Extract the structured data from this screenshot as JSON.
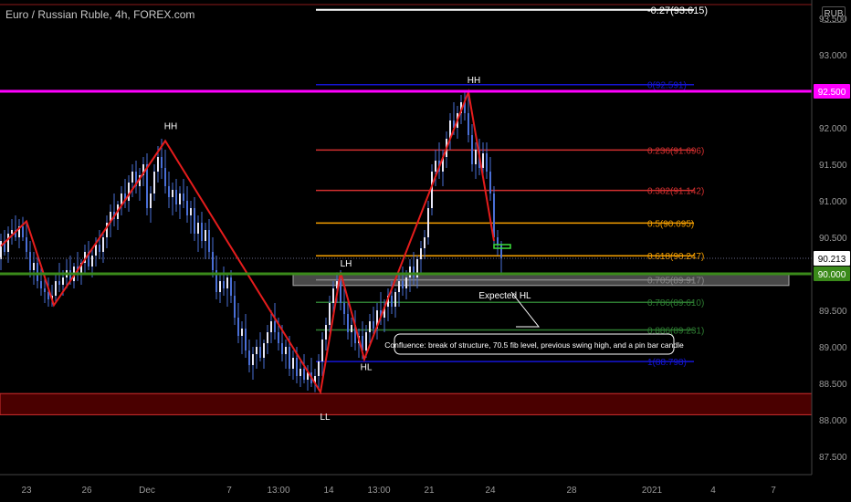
{
  "header": {
    "title": "Euro / Russian Ruble, 4h, FOREX.com",
    "currency_button": "RUB"
  },
  "colors": {
    "background": "#000000",
    "candle": "#4a6fd6",
    "zigzag": "#e51c1c",
    "magenta": "#ff00ff",
    "green": "#3a8a1a",
    "fib_red": "#d32f2f",
    "fib_orange": "#f59f00",
    "fib_green": "#2e7d32",
    "fib_blue": "#1515d6",
    "zone_fill": "#4a0000",
    "zone_border": "#d32f2f"
  },
  "chart_data": {
    "type": "candlestick",
    "symbol": "Euro / Russian Ruble",
    "timeframe": "4h",
    "source": "FOREX.com",
    "y_axis": {
      "range": [
        87.25,
        93.75
      ],
      "ticks": [
        "93.500",
        "93.000",
        "92.500",
        "92.000",
        "91.500",
        "91.000",
        "90.500",
        "90.000",
        "89.500",
        "89.000",
        "88.500",
        "88.000",
        "87.500"
      ]
    },
    "x_axis": {
      "ticks": [
        "23",
        "26",
        "Dec",
        "7",
        "13:00",
        "14",
        "13:00",
        "21",
        "24",
        "28",
        "2021",
        "4",
        "7"
      ]
    },
    "price_labels": [
      {
        "value": "92.500",
        "bg": "#ff00ff",
        "fg": "#ffffff",
        "price": 92.5
      },
      {
        "value": "90.213",
        "bg": "#ffffff",
        "fg": "#000000",
        "price": 90.213
      },
      {
        "value": "90.000",
        "bg": "#3a8a1a",
        "fg": "#ffffff",
        "price": 90.0
      }
    ],
    "horizontal_levels": [
      {
        "name": "magenta-level",
        "price": 92.5,
        "color": "#ff00ff"
      },
      {
        "name": "green-level",
        "price": 90.0,
        "color": "#3a8a1a"
      }
    ],
    "fibonacci": [
      {
        "label": "-0.27(93.615)",
        "price": 93.615,
        "color": "#ffffff"
      },
      {
        "label": "0(92.591)",
        "price": 92.591,
        "color": "#1515d6"
      },
      {
        "label": "0.236(91.696)",
        "price": 91.696,
        "color": "#d32f2f"
      },
      {
        "label": "0.382(91.142)",
        "price": 91.142,
        "color": "#d32f2f"
      },
      {
        "label": "0.5(90.695)",
        "price": 90.695,
        "color": "#f59f00"
      },
      {
        "label": "0.618(90.247)",
        "price": 90.247,
        "color": "#f59f00"
      },
      {
        "label": "0.705(89.917)",
        "price": 89.917,
        "color": "#888888"
      },
      {
        "label": "0.786(89.610)",
        "price": 89.61,
        "color": "#2e7d32"
      },
      {
        "label": "0.886(89.231)",
        "price": 89.231,
        "color": "#2e7d32"
      },
      {
        "label": "1(88.798)",
        "price": 88.798,
        "color": "#1515d6"
      }
    ],
    "zigzag": [
      {
        "t": 0,
        "price": 90.38
      },
      {
        "t": 28,
        "price": 90.72
      },
      {
        "t": 58,
        "price": 89.57
      },
      {
        "t": 180,
        "price": 91.82
      },
      {
        "t": 350,
        "price": 88.38
      },
      {
        "t": 372,
        "price": 90.02
      },
      {
        "t": 398,
        "price": 88.83
      },
      {
        "t": 512,
        "price": 92.49
      },
      {
        "t": 540,
        "price": 90.45
      }
    ],
    "swing_labels": [
      {
        "text": "HH",
        "t": 186,
        "price": 91.98
      },
      {
        "text": "LH",
        "t": 378,
        "price": 90.1
      },
      {
        "text": "HL",
        "t": 400,
        "price": 88.68
      },
      {
        "text": "HH",
        "t": 518,
        "price": 92.61
      },
      {
        "text": "LL",
        "t": 355,
        "price": 88.0
      }
    ],
    "annotations": {
      "expected_label": "Expected HL",
      "note": "Confluence: break of structure, 70.5 fib level, previous swing high, and a pin bar candle"
    },
    "candles": [
      {
        "t": 0,
        "o": 90.2,
        "h": 90.55,
        "l": 90.05,
        "c": 90.45
      },
      {
        "t": 4,
        "o": 90.45,
        "h": 90.6,
        "l": 90.25,
        "c": 90.3
      },
      {
        "t": 8,
        "o": 90.3,
        "h": 90.65,
        "l": 90.15,
        "c": 90.55
      },
      {
        "t": 12,
        "o": 90.55,
        "h": 90.75,
        "l": 90.4,
        "c": 90.6
      },
      {
        "t": 16,
        "o": 90.6,
        "h": 90.8,
        "l": 90.45,
        "c": 90.5
      },
      {
        "t": 20,
        "o": 90.5,
        "h": 90.75,
        "l": 90.35,
        "c": 90.65
      },
      {
        "t": 24,
        "o": 90.65,
        "h": 90.78,
        "l": 90.45,
        "c": 90.5
      },
      {
        "t": 28,
        "o": 90.5,
        "h": 90.7,
        "l": 90.2,
        "c": 90.3
      },
      {
        "t": 32,
        "o": 90.3,
        "h": 90.45,
        "l": 89.95,
        "c": 90.05
      },
      {
        "t": 36,
        "o": 90.05,
        "h": 90.3,
        "l": 89.85,
        "c": 90.15
      },
      {
        "t": 40,
        "o": 90.15,
        "h": 90.25,
        "l": 89.8,
        "c": 89.9
      },
      {
        "t": 44,
        "o": 89.9,
        "h": 90.1,
        "l": 89.7,
        "c": 89.8
      },
      {
        "t": 48,
        "o": 89.8,
        "h": 90.0,
        "l": 89.6,
        "c": 89.75
      },
      {
        "t": 52,
        "o": 89.75,
        "h": 89.95,
        "l": 89.55,
        "c": 89.65
      },
      {
        "t": 56,
        "o": 89.65,
        "h": 89.85,
        "l": 89.55,
        "c": 89.7
      },
      {
        "t": 60,
        "o": 89.7,
        "h": 90.0,
        "l": 89.6,
        "c": 89.9
      },
      {
        "t": 64,
        "o": 89.9,
        "h": 90.15,
        "l": 89.75,
        "c": 89.85
      },
      {
        "t": 68,
        "o": 89.85,
        "h": 90.05,
        "l": 89.7,
        "c": 89.95
      },
      {
        "t": 72,
        "o": 89.95,
        "h": 90.2,
        "l": 89.8,
        "c": 90.05
      },
      {
        "t": 76,
        "o": 90.05,
        "h": 90.25,
        "l": 89.85,
        "c": 89.9
      },
      {
        "t": 80,
        "o": 89.9,
        "h": 90.15,
        "l": 89.8,
        "c": 90.1
      },
      {
        "t": 84,
        "o": 90.1,
        "h": 90.3,
        "l": 89.9,
        "c": 90.0
      },
      {
        "t": 88,
        "o": 90.0,
        "h": 90.2,
        "l": 89.85,
        "c": 90.15
      },
      {
        "t": 92,
        "o": 90.15,
        "h": 90.4,
        "l": 90.0,
        "c": 90.3
      },
      {
        "t": 96,
        "o": 90.3,
        "h": 90.45,
        "l": 90.05,
        "c": 90.1
      },
      {
        "t": 100,
        "o": 90.1,
        "h": 90.35,
        "l": 89.95,
        "c": 90.25
      },
      {
        "t": 104,
        "o": 90.25,
        "h": 90.5,
        "l": 90.1,
        "c": 90.4
      },
      {
        "t": 108,
        "o": 90.4,
        "h": 90.6,
        "l": 90.2,
        "c": 90.3
      },
      {
        "t": 112,
        "o": 90.3,
        "h": 90.55,
        "l": 90.15,
        "c": 90.5
      },
      {
        "t": 116,
        "o": 90.5,
        "h": 90.8,
        "l": 90.35,
        "c": 90.7
      },
      {
        "t": 120,
        "o": 90.7,
        "h": 90.95,
        "l": 90.5,
        "c": 90.85
      },
      {
        "t": 124,
        "o": 90.85,
        "h": 91.1,
        "l": 90.65,
        "c": 90.75
      },
      {
        "t": 128,
        "o": 90.75,
        "h": 91.0,
        "l": 90.6,
        "c": 90.95
      },
      {
        "t": 132,
        "o": 90.95,
        "h": 91.2,
        "l": 90.8,
        "c": 91.1
      },
      {
        "t": 136,
        "o": 91.1,
        "h": 91.3,
        "l": 90.9,
        "c": 91.0
      },
      {
        "t": 140,
        "o": 91.0,
        "h": 91.35,
        "l": 90.85,
        "c": 91.25
      },
      {
        "t": 144,
        "o": 91.25,
        "h": 91.5,
        "l": 91.05,
        "c": 91.4
      },
      {
        "t": 148,
        "o": 91.4,
        "h": 91.55,
        "l": 91.1,
        "c": 91.2
      },
      {
        "t": 152,
        "o": 91.2,
        "h": 91.45,
        "l": 91.0,
        "c": 91.35
      },
      {
        "t": 156,
        "o": 91.35,
        "h": 91.6,
        "l": 91.2,
        "c": 91.5
      },
      {
        "t": 160,
        "o": 91.5,
        "h": 91.65,
        "l": 90.8,
        "c": 90.9
      },
      {
        "t": 164,
        "o": 90.9,
        "h": 91.2,
        "l": 90.7,
        "c": 91.1
      },
      {
        "t": 168,
        "o": 91.1,
        "h": 91.5,
        "l": 91.0,
        "c": 91.4
      },
      {
        "t": 172,
        "o": 91.4,
        "h": 91.75,
        "l": 91.25,
        "c": 91.6
      },
      {
        "t": 176,
        "o": 91.6,
        "h": 91.85,
        "l": 91.3,
        "c": 91.45
      },
      {
        "t": 180,
        "o": 91.45,
        "h": 91.7,
        "l": 91.1,
        "c": 91.2
      },
      {
        "t": 184,
        "o": 91.2,
        "h": 91.4,
        "l": 90.9,
        "c": 91.05
      },
      {
        "t": 188,
        "o": 91.05,
        "h": 91.25,
        "l": 90.8,
        "c": 91.15
      },
      {
        "t": 192,
        "o": 91.15,
        "h": 91.3,
        "l": 90.85,
        "c": 90.95
      },
      {
        "t": 196,
        "o": 90.95,
        "h": 91.2,
        "l": 90.75,
        "c": 91.1
      },
      {
        "t": 200,
        "o": 91.1,
        "h": 91.3,
        "l": 90.9,
        "c": 91.0
      },
      {
        "t": 204,
        "o": 91.0,
        "h": 91.2,
        "l": 90.7,
        "c": 90.8
      },
      {
        "t": 208,
        "o": 90.8,
        "h": 91.0,
        "l": 90.55,
        "c": 90.9
      },
      {
        "t": 212,
        "o": 90.9,
        "h": 91.05,
        "l": 90.45,
        "c": 90.55
      },
      {
        "t": 216,
        "o": 90.55,
        "h": 90.8,
        "l": 90.3,
        "c": 90.7
      },
      {
        "t": 220,
        "o": 90.7,
        "h": 90.85,
        "l": 90.35,
        "c": 90.45
      },
      {
        "t": 224,
        "o": 90.45,
        "h": 90.7,
        "l": 90.2,
        "c": 90.6
      },
      {
        "t": 228,
        "o": 90.6,
        "h": 90.75,
        "l": 90.2,
        "c": 90.3
      },
      {
        "t": 232,
        "o": 90.3,
        "h": 90.5,
        "l": 89.95,
        "c": 90.05
      },
      {
        "t": 236,
        "o": 90.05,
        "h": 90.25,
        "l": 89.65,
        "c": 89.75
      },
      {
        "t": 240,
        "o": 89.75,
        "h": 90.0,
        "l": 89.6,
        "c": 89.9
      },
      {
        "t": 244,
        "o": 89.9,
        "h": 90.1,
        "l": 89.7,
        "c": 89.8
      },
      {
        "t": 248,
        "o": 89.8,
        "h": 90.0,
        "l": 89.55,
        "c": 89.95
      },
      {
        "t": 252,
        "o": 89.95,
        "h": 90.05,
        "l": 89.6,
        "c": 89.7
      },
      {
        "t": 256,
        "o": 89.7,
        "h": 89.9,
        "l": 89.3,
        "c": 89.4
      },
      {
        "t": 260,
        "o": 89.4,
        "h": 89.6,
        "l": 89.05,
        "c": 89.15
      },
      {
        "t": 264,
        "o": 89.15,
        "h": 89.35,
        "l": 88.9,
        "c": 89.25
      },
      {
        "t": 268,
        "o": 89.25,
        "h": 89.45,
        "l": 88.85,
        "c": 88.95
      },
      {
        "t": 272,
        "o": 88.95,
        "h": 89.1,
        "l": 88.65,
        "c": 88.75
      },
      {
        "t": 276,
        "o": 88.75,
        "h": 89.0,
        "l": 88.55,
        "c": 88.9
      },
      {
        "t": 280,
        "o": 88.9,
        "h": 89.1,
        "l": 88.7,
        "c": 89.0
      },
      {
        "t": 284,
        "o": 89.0,
        "h": 89.2,
        "l": 88.8,
        "c": 88.85
      },
      {
        "t": 288,
        "o": 88.85,
        "h": 89.1,
        "l": 88.7,
        "c": 89.05
      },
      {
        "t": 292,
        "o": 89.05,
        "h": 89.3,
        "l": 88.9,
        "c": 89.2
      },
      {
        "t": 296,
        "o": 89.2,
        "h": 89.5,
        "l": 89.05,
        "c": 89.35
      },
      {
        "t": 300,
        "o": 89.35,
        "h": 89.6,
        "l": 89.1,
        "c": 89.2
      },
      {
        "t": 304,
        "o": 89.2,
        "h": 89.4,
        "l": 88.95,
        "c": 89.05
      },
      {
        "t": 308,
        "o": 89.05,
        "h": 89.3,
        "l": 88.8,
        "c": 88.9
      },
      {
        "t": 312,
        "o": 88.9,
        "h": 89.1,
        "l": 88.7,
        "c": 89.0
      },
      {
        "t": 316,
        "o": 89.0,
        "h": 89.15,
        "l": 88.6,
        "c": 88.7
      },
      {
        "t": 320,
        "o": 88.7,
        "h": 88.95,
        "l": 88.55,
        "c": 88.85
      },
      {
        "t": 324,
        "o": 88.85,
        "h": 89.0,
        "l": 88.5,
        "c": 88.6
      },
      {
        "t": 328,
        "o": 88.6,
        "h": 88.8,
        "l": 88.45,
        "c": 88.7
      },
      {
        "t": 332,
        "o": 88.7,
        "h": 88.9,
        "l": 88.5,
        "c": 88.55
      },
      {
        "t": 336,
        "o": 88.55,
        "h": 88.75,
        "l": 88.4,
        "c": 88.65
      },
      {
        "t": 340,
        "o": 88.65,
        "h": 88.85,
        "l": 88.45,
        "c": 88.5
      },
      {
        "t": 344,
        "o": 88.5,
        "h": 88.7,
        "l": 88.38,
        "c": 88.6
      },
      {
        "t": 348,
        "o": 88.6,
        "h": 88.9,
        "l": 88.4,
        "c": 88.8
      },
      {
        "t": 352,
        "o": 88.8,
        "h": 89.2,
        "l": 88.6,
        "c": 89.1
      },
      {
        "t": 356,
        "o": 89.1,
        "h": 89.4,
        "l": 88.95,
        "c": 89.3
      },
      {
        "t": 360,
        "o": 89.3,
        "h": 89.7,
        "l": 89.2,
        "c": 89.6
      },
      {
        "t": 364,
        "o": 89.6,
        "h": 89.9,
        "l": 89.4,
        "c": 89.8
      },
      {
        "t": 368,
        "o": 89.8,
        "h": 90.02,
        "l": 89.6,
        "c": 89.9
      },
      {
        "t": 372,
        "o": 89.9,
        "h": 90.05,
        "l": 89.5,
        "c": 89.6
      },
      {
        "t": 376,
        "o": 89.6,
        "h": 89.8,
        "l": 89.3,
        "c": 89.45
      },
      {
        "t": 380,
        "o": 89.45,
        "h": 89.6,
        "l": 89.1,
        "c": 89.2
      },
      {
        "t": 384,
        "o": 89.2,
        "h": 89.4,
        "l": 89.0,
        "c": 89.3
      },
      {
        "t": 388,
        "o": 89.3,
        "h": 89.5,
        "l": 88.95,
        "c": 89.05
      },
      {
        "t": 392,
        "o": 89.05,
        "h": 89.25,
        "l": 88.85,
        "c": 89.15
      },
      {
        "t": 396,
        "o": 89.15,
        "h": 89.35,
        "l": 88.83,
        "c": 88.95
      },
      {
        "t": 400,
        "o": 88.95,
        "h": 89.3,
        "l": 88.85,
        "c": 89.2
      },
      {
        "t": 404,
        "o": 89.2,
        "h": 89.45,
        "l": 89.05,
        "c": 89.35
      },
      {
        "t": 408,
        "o": 89.35,
        "h": 89.55,
        "l": 89.15,
        "c": 89.25
      },
      {
        "t": 412,
        "o": 89.25,
        "h": 89.6,
        "l": 89.1,
        "c": 89.5
      },
      {
        "t": 416,
        "o": 89.5,
        "h": 89.75,
        "l": 89.3,
        "c": 89.4
      },
      {
        "t": 420,
        "o": 89.4,
        "h": 89.65,
        "l": 89.2,
        "c": 89.55
      },
      {
        "t": 424,
        "o": 89.55,
        "h": 89.8,
        "l": 89.35,
        "c": 89.7
      },
      {
        "t": 428,
        "o": 89.7,
        "h": 89.9,
        "l": 89.45,
        "c": 89.55
      },
      {
        "t": 432,
        "o": 89.55,
        "h": 89.8,
        "l": 89.4,
        "c": 89.75
      },
      {
        "t": 436,
        "o": 89.75,
        "h": 90.0,
        "l": 89.55,
        "c": 89.9
      },
      {
        "t": 440,
        "o": 89.9,
        "h": 90.1,
        "l": 89.7,
        "c": 89.8
      },
      {
        "t": 444,
        "o": 89.8,
        "h": 90.05,
        "l": 89.65,
        "c": 89.95
      },
      {
        "t": 448,
        "o": 89.95,
        "h": 90.2,
        "l": 89.75,
        "c": 90.1
      },
      {
        "t": 452,
        "o": 90.1,
        "h": 90.3,
        "l": 89.85,
        "c": 89.95
      },
      {
        "t": 456,
        "o": 89.95,
        "h": 90.25,
        "l": 89.8,
        "c": 90.2
      },
      {
        "t": 460,
        "o": 90.2,
        "h": 90.45,
        "l": 90.0,
        "c": 90.35
      },
      {
        "t": 464,
        "o": 90.35,
        "h": 90.6,
        "l": 90.2,
        "c": 90.5
      },
      {
        "t": 468,
        "o": 90.5,
        "h": 91.0,
        "l": 90.4,
        "c": 90.9
      },
      {
        "t": 472,
        "o": 90.9,
        "h": 91.5,
        "l": 90.8,
        "c": 91.4
      },
      {
        "t": 476,
        "o": 91.4,
        "h": 91.7,
        "l": 91.2,
        "c": 91.55
      },
      {
        "t": 480,
        "o": 91.55,
        "h": 91.8,
        "l": 91.3,
        "c": 91.4
      },
      {
        "t": 484,
        "o": 91.4,
        "h": 91.7,
        "l": 91.2,
        "c": 91.6
      },
      {
        "t": 488,
        "o": 91.6,
        "h": 91.95,
        "l": 91.45,
        "c": 91.85
      },
      {
        "t": 492,
        "o": 91.85,
        "h": 92.2,
        "l": 91.7,
        "c": 92.1
      },
      {
        "t": 496,
        "o": 92.1,
        "h": 92.35,
        "l": 91.9,
        "c": 92.0
      },
      {
        "t": 500,
        "o": 92.0,
        "h": 92.3,
        "l": 91.85,
        "c": 92.2
      },
      {
        "t": 504,
        "o": 92.2,
        "h": 92.45,
        "l": 92.05,
        "c": 92.35
      },
      {
        "t": 508,
        "o": 92.35,
        "h": 92.49,
        "l": 92.1,
        "c": 92.2
      },
      {
        "t": 512,
        "o": 92.2,
        "h": 92.45,
        "l": 91.8,
        "c": 91.9
      },
      {
        "t": 516,
        "o": 91.9,
        "h": 92.05,
        "l": 91.4,
        "c": 91.5
      },
      {
        "t": 520,
        "o": 91.5,
        "h": 91.8,
        "l": 91.3,
        "c": 91.7
      },
      {
        "t": 524,
        "o": 91.7,
        "h": 91.85,
        "l": 91.35,
        "c": 91.45
      },
      {
        "t": 528,
        "o": 91.45,
        "h": 91.8,
        "l": 91.3,
        "c": 91.65
      },
      {
        "t": 532,
        "o": 91.65,
        "h": 91.8,
        "l": 91.3,
        "c": 91.4
      },
      {
        "t": 536,
        "o": 91.4,
        "h": 91.6,
        "l": 91.0,
        "c": 91.1
      },
      {
        "t": 540,
        "o": 91.1,
        "h": 91.2,
        "l": 90.4,
        "c": 90.5
      },
      {
        "t": 544,
        "o": 90.5,
        "h": 90.6,
        "l": 90.25,
        "c": 90.4
      },
      {
        "t": 548,
        "o": 90.4,
        "h": 90.45,
        "l": 89.98,
        "c": 90.21
      }
    ]
  }
}
